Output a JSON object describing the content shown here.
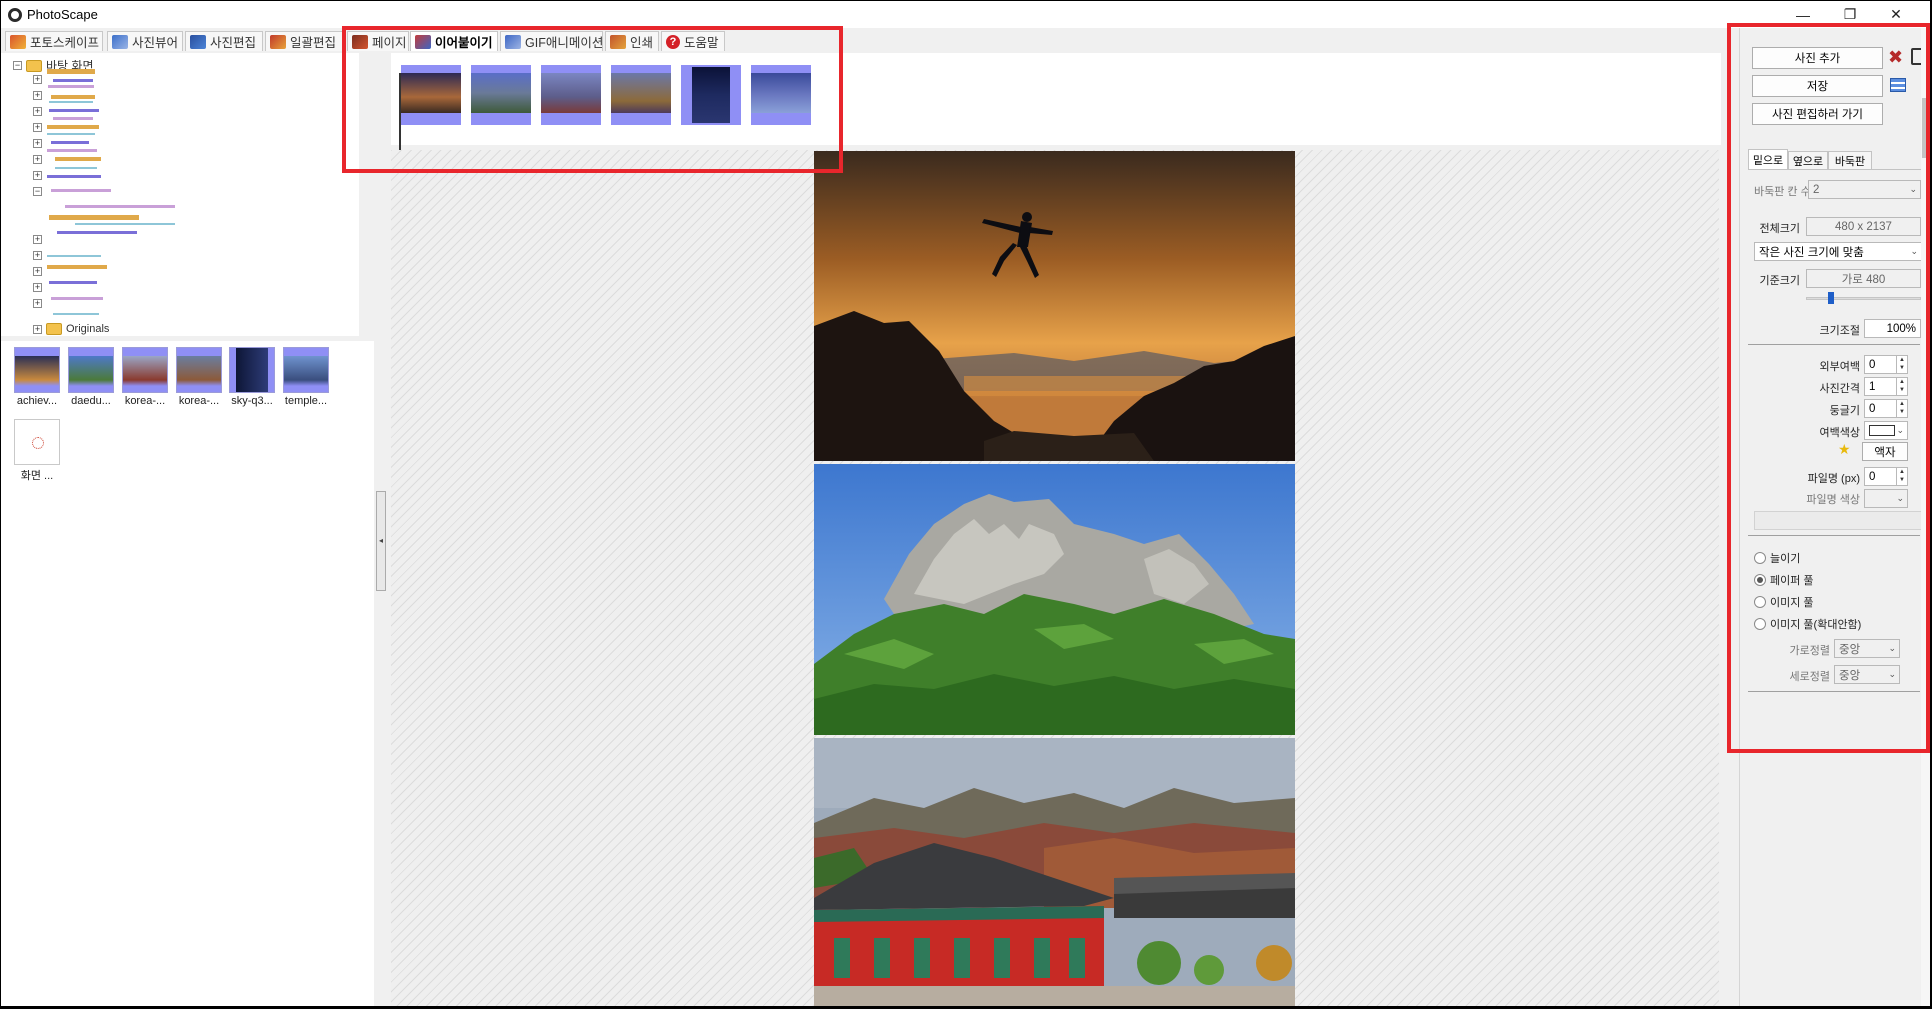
{
  "window": {
    "title": "PhotoScape",
    "minimize_glyph": "—",
    "maximize_glyph": "❐",
    "close_glyph": "✕"
  },
  "tabs": [
    {
      "label": "포토스케이프",
      "icon": "photoscape-icon"
    },
    {
      "label": "사진뷰어",
      "icon": "viewer-icon"
    },
    {
      "label": "사진편집",
      "icon": "editor-icon"
    },
    {
      "label": "일괄편집",
      "icon": "batch-icon"
    },
    {
      "label": "페이지",
      "icon": "page-icon"
    },
    {
      "label": "이어붙이기",
      "icon": "combine-icon",
      "active": true
    },
    {
      "label": "GIF애니메이션",
      "icon": "gif-icon"
    },
    {
      "label": "인쇄",
      "icon": "print-icon"
    },
    {
      "label": "도움말",
      "icon": "help-icon"
    }
  ],
  "folder_tree": {
    "root_label": "바탕 화면",
    "last_visible_label": "Originals"
  },
  "file_thumbs": [
    {
      "label": "achiev...",
      "color_top": "#2a2f55",
      "color_bottom": "#c98a3e"
    },
    {
      "label": "daedu...",
      "color_top": "#4e79c9",
      "color_bottom": "#4b7a3a"
    },
    {
      "label": "korea-...",
      "color_top": "#9aa6c6",
      "color_bottom": "#8a3a2e"
    },
    {
      "label": "korea-...",
      "color_top": "#6a7ea0",
      "color_bottom": "#8c5a3a"
    },
    {
      "label": "sky-q3...",
      "color_top": "#0d1636",
      "color_bottom": "#2e3c78"
    },
    {
      "label": "temple...",
      "color_top": "#6f93cf",
      "color_bottom": "#3a4e7e"
    },
    {
      "label": "화면 ...",
      "color_top": "#ffffff",
      "color_bottom": "#ffffff"
    }
  ],
  "strip_thumbs": [
    {
      "name": "jump",
      "top": "#2d2a55",
      "bottom": "#8a5a3a"
    },
    {
      "name": "mountain",
      "top": "#5a6ec8",
      "bottom": "#3e5a3a"
    },
    {
      "name": "temple",
      "top": "#7b86c2",
      "bottom": "#7a3a3a"
    },
    {
      "name": "autumn",
      "top": "#6b78a8",
      "bottom": "#8c6a3a"
    },
    {
      "name": "sky",
      "top": "#0b1238",
      "bottom": "#2a3670",
      "tall": true
    },
    {
      "name": "sea",
      "top": "#3a4a9a",
      "bottom": "#8aa0d8"
    }
  ],
  "panel": {
    "add_photo": "사진 추가",
    "save": "저장",
    "go_edit": "사진 편집하러 가기",
    "tab_down": "밑으로",
    "tab_side": "옆으로",
    "tab_grid": "바둑판",
    "grid_count_label": "바둑판 칸 수",
    "grid_count_value": "2",
    "total_size_label": "전체크기",
    "total_size_value": "480 x 2137",
    "fit_option": "작은 사진 크기에 맞춤",
    "base_size_label": "기준크기",
    "base_size_value": "가로 480",
    "scale_label": "크기조절",
    "scale_value": "100%",
    "outer_margin_label": "외부여백",
    "outer_margin_value": "0",
    "spacing_label": "사진간격",
    "spacing_value": "1",
    "rounding_label": "둥글기",
    "rounding_value": "0",
    "margin_color_label": "여백색상",
    "frame_button": "액자",
    "filename_px_label": "파일명 (px)",
    "filename_px_value": "0",
    "filename_color_label": "파일명 색상",
    "radio_stretch": "늘이기",
    "radio_paper_fill": "페이퍼 풀",
    "radio_image_fill": "이미지 풀",
    "radio_image_fill_zoom": "이미지 풀(확대안함)",
    "h_align_label": "가로정렬",
    "h_align_value": "중앙",
    "v_align_label": "세로정렬",
    "v_align_value": "중앙",
    "selected_radio": "radio_paper_fill"
  },
  "colors": {
    "highlight": "#e8262c",
    "thumb_bg": "#8f8ff5"
  }
}
